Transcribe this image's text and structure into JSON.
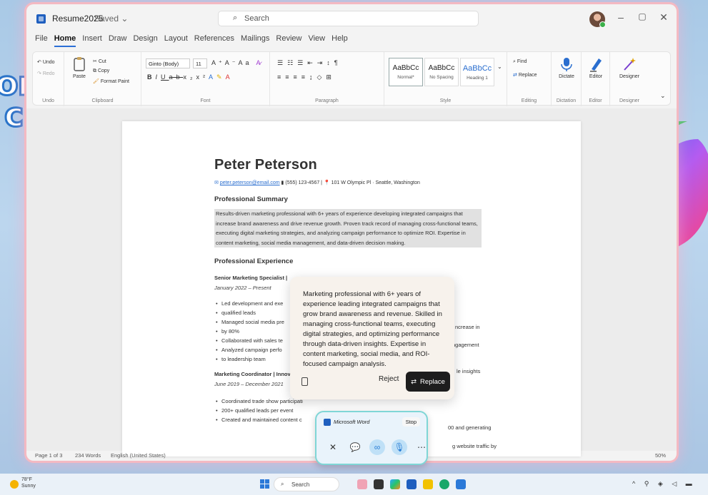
{
  "decor": {
    "text_lines": [
      "on",
      "c"
    ]
  },
  "titlebar": {
    "doc_title": "Resume2025",
    "saved": "Saved ⌄",
    "search_placeholder": "Search"
  },
  "menu": [
    "File",
    "Home",
    "Insert",
    "Draw",
    "Design",
    "Layout",
    "References",
    "Mailings",
    "Review",
    "View",
    "Help"
  ],
  "ribbon": {
    "undo": "Undo",
    "redo": "Redo",
    "paste": "Paste",
    "cut": "Cut",
    "copy": "Copy",
    "format_paint": "Format Paint",
    "font_name": "Ginto (Body)",
    "font_size": "11",
    "group_undo": "Undo",
    "group_clipboard": "Clipboard",
    "group_font": "Font",
    "group_paragraph": "Paragraph",
    "group_style": "Style",
    "group_editing": "Editing",
    "group_dictation": "Dictation",
    "group_editor": "Editor",
    "group_designer": "Designer",
    "styles": [
      {
        "sample": "AaBbCc",
        "name": "Normal*"
      },
      {
        "sample": "AaBbCc",
        "name": "No Spacing"
      },
      {
        "sample": "AaBbCc",
        "name": "Heading 1"
      }
    ],
    "find": "Find",
    "replace": "Replace",
    "dictate": "Dictate",
    "editor": "Editor",
    "designer": "Designer"
  },
  "document": {
    "name": "Peter Peterson",
    "email": "peter.peterson@email.com",
    "phone": "(555) 123-4567",
    "address": "101 W Olympic Pl · Seattle, Washington",
    "summary_heading": "Professional Summary",
    "summary": "Results-driven marketing professional with 6+ years of experience developing integrated campaigns that increase brand awareness and drive revenue growth. Proven track record of managing cross-functional teams, executing digital marketing strategies, and analyzing campaign performance to optimize ROI. Expertise in content marketing, social media management, and data-driven decision making.",
    "experience_heading": "Professional Experience",
    "job1_title": "Senior Marketing Specialist |",
    "job1_date": "January 2022 – Present",
    "job1_bullets": [
      "Led development and exe",
      "qualified leads",
      "Managed social media pre",
      "by 80%",
      "Collaborated with sales te",
      "Analyzed campaign perfo",
      "to leadership team"
    ],
    "job1_right": [
      "ncrease in",
      "ngagement",
      "le insights"
    ],
    "job2_title": "Marketing Coordinator | Innov",
    "job2_date": "June 2019 – December 2021",
    "job2_bullets": [
      "Coordinated trade show participati",
      "200+ qualified leads per event",
      "Created and maintained content c"
    ],
    "job2_right": [
      "00 and generating",
      "g website traffic by"
    ]
  },
  "popup": {
    "text": "Marketing professional with 6+ years of experience leading integrated campaigns that grow brand awareness and revenue. Skilled in managing cross-functional teams, executing digital strategies, and optimizing performance through data-driven insights. Expertise in content marketing, social media, and ROI-focused campaign analysis.",
    "reject": "Reject",
    "replace": "Replace"
  },
  "mini_toolbar": {
    "app": "Microsoft Word",
    "stop": "Stop"
  },
  "statusbar": {
    "page": "Page 1 of 3",
    "words": "234 Words",
    "language": "English (United States)",
    "zoom": "50%"
  },
  "taskbar": {
    "temp": "78°F",
    "condition": "Sunny",
    "search": "Search"
  }
}
